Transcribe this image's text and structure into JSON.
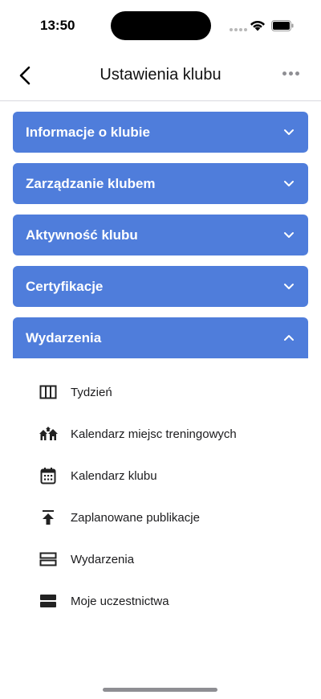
{
  "status_bar": {
    "time": "13:50"
  },
  "header": {
    "title": "Ustawienia klubu"
  },
  "accordion": [
    {
      "label": "Informacje o klubie",
      "expanded": false
    },
    {
      "label": "Zarządzanie klubem",
      "expanded": false
    },
    {
      "label": "Aktywność klubu",
      "expanded": false
    },
    {
      "label": "Certyfikacje",
      "expanded": false
    },
    {
      "label": "Wydarzenia",
      "expanded": true
    }
  ],
  "events_menu": [
    {
      "label": "Tydzień",
      "icon": "week-columns-icon"
    },
    {
      "label": "Kalendarz miejsc treningowych",
      "icon": "houses-icon"
    },
    {
      "label": "Kalendarz klubu",
      "icon": "calendar-icon"
    },
    {
      "label": "Zaplanowane publikacje",
      "icon": "publish-upload-icon"
    },
    {
      "label": "Wydarzenia",
      "icon": "view-agenda-icon"
    },
    {
      "label": "Moje uczestnictwa",
      "icon": "view-stream-icon"
    }
  ],
  "colors": {
    "accent": "#4f7ddb",
    "divider": "#d9d9de",
    "text": "#1c1c1e"
  }
}
